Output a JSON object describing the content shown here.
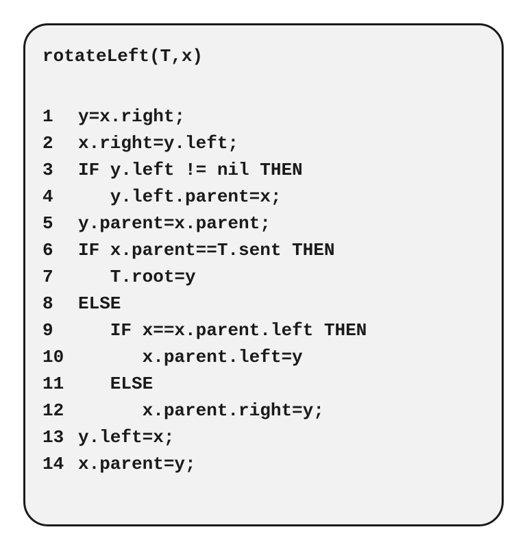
{
  "title": "rotateLeft(T,x)",
  "lines": [
    {
      "num": "1",
      "text": "y=x.right;"
    },
    {
      "num": "2",
      "text": "x.right=y.left;"
    },
    {
      "num": "3",
      "text": "IF y.left != nil THEN"
    },
    {
      "num": "4",
      "text": "   y.left.parent=x;"
    },
    {
      "num": "5",
      "text": "y.parent=x.parent;"
    },
    {
      "num": "6",
      "text": "IF x.parent==T.sent THEN"
    },
    {
      "num": "7",
      "text": "   T.root=y"
    },
    {
      "num": "8",
      "text": "ELSE"
    },
    {
      "num": "9",
      "text": "   IF x==x.parent.left THEN"
    },
    {
      "num": "10",
      "text": "      x.parent.left=y"
    },
    {
      "num": "11",
      "text": "   ELSE"
    },
    {
      "num": "12",
      "text": "      x.parent.right=y;"
    },
    {
      "num": "13",
      "text": "y.left=x;"
    },
    {
      "num": "14",
      "text": "x.parent=y;"
    }
  ]
}
